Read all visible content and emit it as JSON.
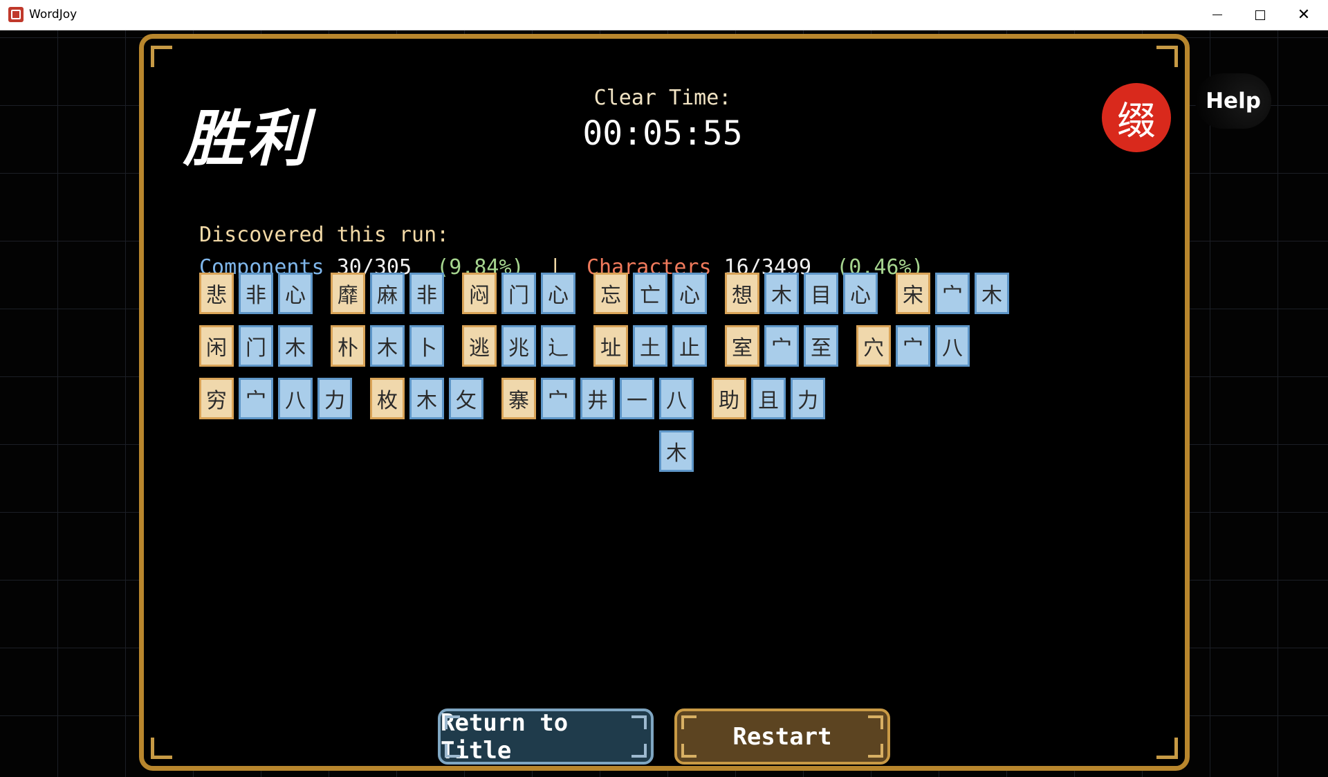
{
  "window": {
    "title": "WordJoy"
  },
  "header": {
    "victory": "胜利",
    "clear_time_label": "Clear Time:",
    "clear_time": "00:05:55",
    "seal_glyph": "缀",
    "help_label": "Help"
  },
  "summary": {
    "discovered_label": "Discovered this run:",
    "components_label": "Components",
    "components_count": "30/305",
    "components_pct": "(9.84%)",
    "separator": "|",
    "characters_label": "Characters",
    "characters_count": "16/3499",
    "characters_pct": "(0.46%)"
  },
  "tiles": [
    [
      "悲",
      "非",
      "心"
    ],
    [
      "靡",
      "麻",
      "非"
    ],
    [
      "闷",
      "门",
      "心"
    ],
    [
      "忘",
      "亡",
      "心"
    ],
    [
      "想",
      "木",
      "目",
      "心"
    ],
    [
      "宋",
      "宀",
      "木"
    ],
    [
      "闲",
      "门",
      "木"
    ],
    [
      "朴",
      "木",
      "卜"
    ],
    [
      "逃",
      "兆",
      "辶"
    ],
    [
      "址",
      "土",
      "止"
    ],
    [
      "室",
      "宀",
      "至"
    ],
    [
      "穴",
      "宀",
      "八"
    ],
    [
      "穷",
      "宀",
      "八",
      "力"
    ],
    [
      "枚",
      "木",
      "攵"
    ],
    [
      "寨",
      "宀",
      "井",
      "一",
      "八",
      "木"
    ],
    [
      "助",
      "且",
      "力"
    ]
  ],
  "buttons": {
    "return_label": "Return to Title",
    "restart_label": "Restart"
  },
  "colors": {
    "frame": "#b8862d",
    "character_tile": "#f0d8ac",
    "component_tile": "#a9cdea",
    "components_text": "#7fb6ea",
    "characters_text": "#f07a5c",
    "percent_text": "#a6d58f"
  }
}
